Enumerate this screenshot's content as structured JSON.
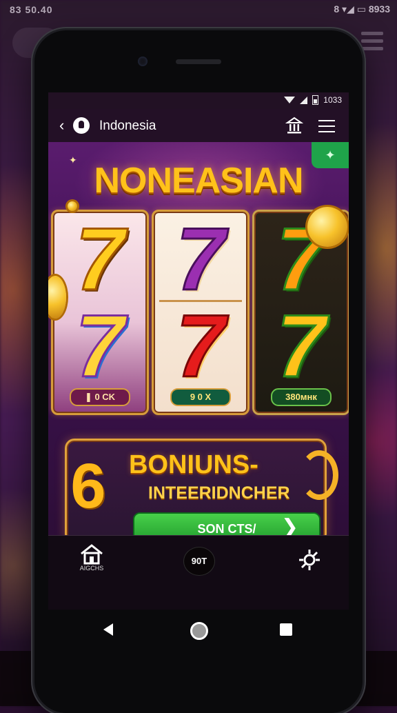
{
  "outer_status": {
    "left": "83 50.40",
    "right": "8 ▾◢ ▭ 8933"
  },
  "status": {
    "time": "1033"
  },
  "appbar": {
    "title": "Indonesia"
  },
  "game": {
    "title": "NONEASIAN",
    "reels": [
      {
        "top": "7",
        "bottom": "7",
        "label": "❚ 0 CK"
      },
      {
        "top": "7",
        "bottom": "7",
        "label": "9 0 X"
      },
      {
        "top": "7",
        "bottom": "7",
        "label": "380мнк"
      }
    ],
    "bonus": {
      "title": "BONIUNS-",
      "subtitle": "INTEERIDNCHER",
      "cta_label": "SON CTS/",
      "cta_arrow": "❯",
      "icon_glyph": "6"
    }
  },
  "bottom_nav": {
    "home_label": "AIGCHS",
    "center_label": "90T"
  },
  "colors": {
    "accent_gold": "#ffc21a",
    "cta_green": "#2fb53a",
    "bg_purple": "#3f1252"
  }
}
